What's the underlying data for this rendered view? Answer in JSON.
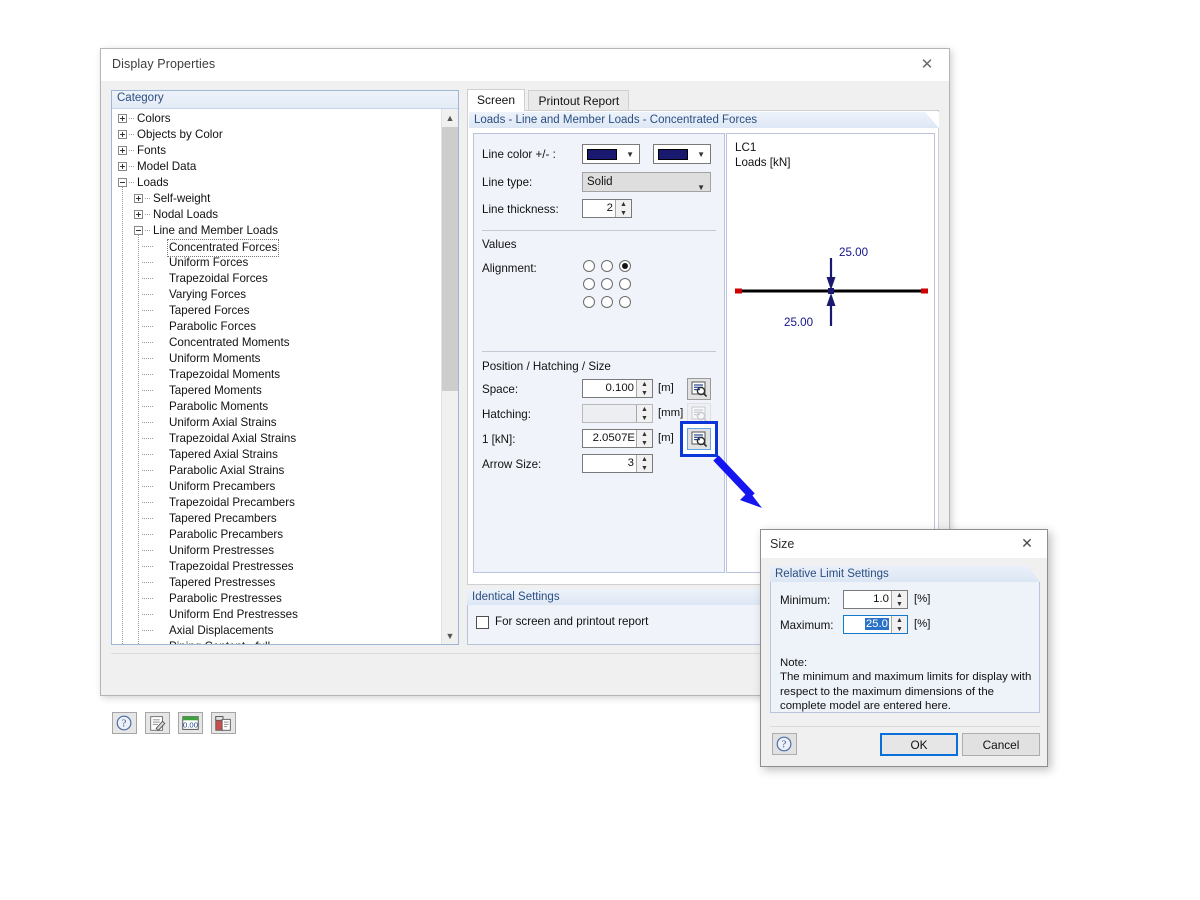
{
  "main_dialog": {
    "title": "Display Properties",
    "close_icon": "close-icon",
    "tree": {
      "header": "Category",
      "items": [
        {
          "label": "Colors",
          "indent": 0,
          "expander": "plus"
        },
        {
          "label": "Objects by Color",
          "indent": 0,
          "expander": "plus"
        },
        {
          "label": "Fonts",
          "indent": 0,
          "expander": "plus"
        },
        {
          "label": "Model Data",
          "indent": 0,
          "expander": "plus"
        },
        {
          "label": "Loads",
          "indent": 0,
          "expander": "minus"
        },
        {
          "label": "Self-weight",
          "indent": 1,
          "expander": "plus"
        },
        {
          "label": "Nodal Loads",
          "indent": 1,
          "expander": "plus"
        },
        {
          "label": "Line and Member Loads",
          "indent": 1,
          "expander": "minus"
        },
        {
          "label": "Concentrated Forces",
          "indent": 2,
          "expander": "none",
          "selected": true
        },
        {
          "label": "Uniform Forces",
          "indent": 2,
          "expander": "none"
        },
        {
          "label": "Trapezoidal Forces",
          "indent": 2,
          "expander": "none"
        },
        {
          "label": "Varying Forces",
          "indent": 2,
          "expander": "none"
        },
        {
          "label": "Tapered Forces",
          "indent": 2,
          "expander": "none"
        },
        {
          "label": "Parabolic Forces",
          "indent": 2,
          "expander": "none"
        },
        {
          "label": "Concentrated Moments",
          "indent": 2,
          "expander": "none"
        },
        {
          "label": "Uniform Moments",
          "indent": 2,
          "expander": "none"
        },
        {
          "label": "Trapezoidal Moments",
          "indent": 2,
          "expander": "none"
        },
        {
          "label": "Tapered Moments",
          "indent": 2,
          "expander": "none"
        },
        {
          "label": "Parabolic Moments",
          "indent": 2,
          "expander": "none"
        },
        {
          "label": "Uniform Axial Strains",
          "indent": 2,
          "expander": "none"
        },
        {
          "label": "Trapezoidal Axial Strains",
          "indent": 2,
          "expander": "none"
        },
        {
          "label": "Tapered Axial Strains",
          "indent": 2,
          "expander": "none"
        },
        {
          "label": "Parabolic Axial Strains",
          "indent": 2,
          "expander": "none"
        },
        {
          "label": "Uniform Precambers",
          "indent": 2,
          "expander": "none"
        },
        {
          "label": "Trapezoidal Precambers",
          "indent": 2,
          "expander": "none"
        },
        {
          "label": "Tapered Precambers",
          "indent": 2,
          "expander": "none"
        },
        {
          "label": "Parabolic Precambers",
          "indent": 2,
          "expander": "none"
        },
        {
          "label": "Uniform Prestresses",
          "indent": 2,
          "expander": "none"
        },
        {
          "label": "Trapezoidal Prestresses",
          "indent": 2,
          "expander": "none"
        },
        {
          "label": "Tapered Prestresses",
          "indent": 2,
          "expander": "none"
        },
        {
          "label": "Parabolic Prestresses",
          "indent": 2,
          "expander": "none"
        },
        {
          "label": "Uniform End Prestresses",
          "indent": 2,
          "expander": "none"
        },
        {
          "label": "Axial Displacements",
          "indent": 2,
          "expander": "none"
        },
        {
          "label": "Piping Content - full",
          "indent": 2,
          "expander": "none"
        }
      ]
    },
    "tabs": [
      {
        "label": "Screen",
        "active": true
      },
      {
        "label": "Printout Report",
        "active": false
      }
    ],
    "group_title": "Loads - Line and Member Loads - Concentrated Forces",
    "fields": {
      "line_color_label": "Line color  +/- :",
      "line_color_plus": "#191970",
      "line_color_minus": "#191970",
      "line_type_label": "Line type:",
      "line_type_value": "Solid",
      "line_thickness_label": "Line thickness:",
      "line_thickness_value": "2",
      "values_label": "Values",
      "alignment_label": "Alignment:",
      "alignment_selected_index": 2,
      "position_section": "Position / Hatching / Size",
      "space_label": "Space:",
      "space_value": "0.100",
      "space_unit": "[m]",
      "hatching_label": "Hatching:",
      "hatching_value": "",
      "hatching_unit": "[mm]",
      "scale_label": "1  [kN]:",
      "scale_value": "2.0507E",
      "scale_unit": "[m]",
      "arrow_size_label": "Arrow Size:",
      "arrow_size_value": "3"
    },
    "preview": {
      "load_case": "LC1",
      "units_caption": "Loads [kN]",
      "value_top": "25.00",
      "value_bottom": "25.00",
      "member_color": "#000000",
      "node_color": "#cc0000",
      "arrow_color": "#191970"
    },
    "identical_settings": {
      "header": "Identical Settings",
      "checkbox_label": "For screen and printout report",
      "checked": false
    },
    "toolbar": [
      {
        "icon": "help-icon"
      },
      {
        "icon": "edit-icon"
      },
      {
        "icon": "numeric-format-icon"
      },
      {
        "icon": "copy-settings-icon"
      }
    ],
    "magnifier_buttons": [
      {
        "icon": "zoom-detail-icon",
        "enabled": true,
        "highlighted": false
      },
      {
        "icon": "zoom-detail-icon",
        "enabled": false,
        "highlighted": false
      },
      {
        "icon": "zoom-detail-icon",
        "enabled": true,
        "highlighted": true
      }
    ]
  },
  "size_dialog": {
    "title": "Size",
    "close_icon": "close-icon",
    "group_header": "Relative Limit Settings",
    "minimum_label": "Minimum:",
    "minimum_value": "1.0",
    "minimum_unit": "[%]",
    "maximum_label": "Maximum:",
    "maximum_value": "25.0",
    "maximum_unit": "[%]",
    "maximum_selected": true,
    "note_title": "Note:",
    "note_body": "The minimum and maximum limits for display with respect to the maximum dimensions of the complete model are entered here.",
    "help_icon": "help-icon",
    "ok_label": "OK",
    "cancel_label": "Cancel"
  },
  "annotation": {
    "arrow_color": "#1515f0",
    "icon": "pointer-arrow-icon"
  }
}
